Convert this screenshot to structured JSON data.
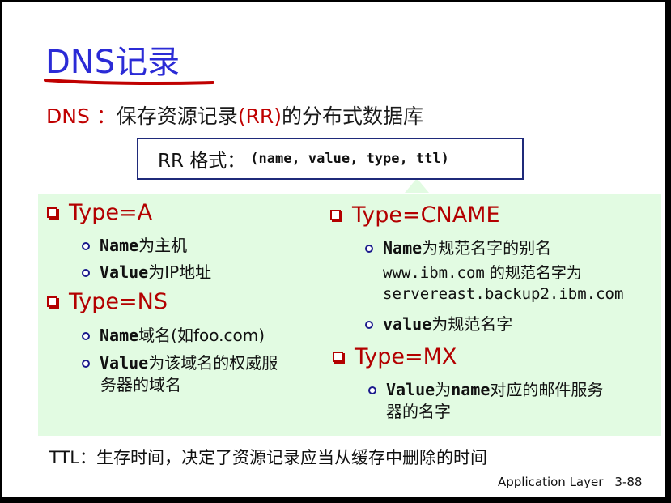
{
  "title": "DNS记录",
  "subtitle": {
    "prefix": "DNS ：",
    "text_before": "保存资源记录",
    "rr": "(RR)",
    "text_after": "的分布式数据库"
  },
  "rr_format": {
    "label": "RR 格式：",
    "fields": "(name, value, type, ttl)"
  },
  "left_column": {
    "type_a": {
      "heading": "Type=A",
      "items": [
        {
          "code": "Name",
          "text": "为主机"
        },
        {
          "code": "Value",
          "text": "为IP地址"
        }
      ]
    },
    "type_ns": {
      "heading": "Type=NS",
      "items": [
        {
          "code": "Name",
          "text": "域名(如foo.com)"
        },
        {
          "code": "Value",
          "text": "为该域名的权威服",
          "text_line2": "务器的域名"
        }
      ]
    }
  },
  "right_column": {
    "type_cname": {
      "heading": "Type=CNAME",
      "item1": {
        "code": "Name",
        "text": "为规范名字的别名"
      },
      "example_line1_code": "www.ibm.com",
      "example_line1_text": " 的规范名字为",
      "example_line2_code": "servereast.backup2.ibm.com",
      "item2": {
        "code": "value",
        "text": " 为规范名字"
      }
    },
    "type_mx": {
      "heading": "Type=MX",
      "item": {
        "code": "Value",
        "text": "为",
        "code2": "name",
        "text2": "对应的邮件服务",
        "text_line2": "器的名字"
      }
    }
  },
  "ttl_note": "TTL：生存时间，决定了资源记录应当从缓存中删除的时间",
  "footer": {
    "label": "Application Layer",
    "page": "3-88"
  },
  "colors": {
    "title": "#2b2bd6",
    "heading_red": "#b30000",
    "green_bg": "#e2fbe2",
    "box_border": "#1f2a7a"
  }
}
